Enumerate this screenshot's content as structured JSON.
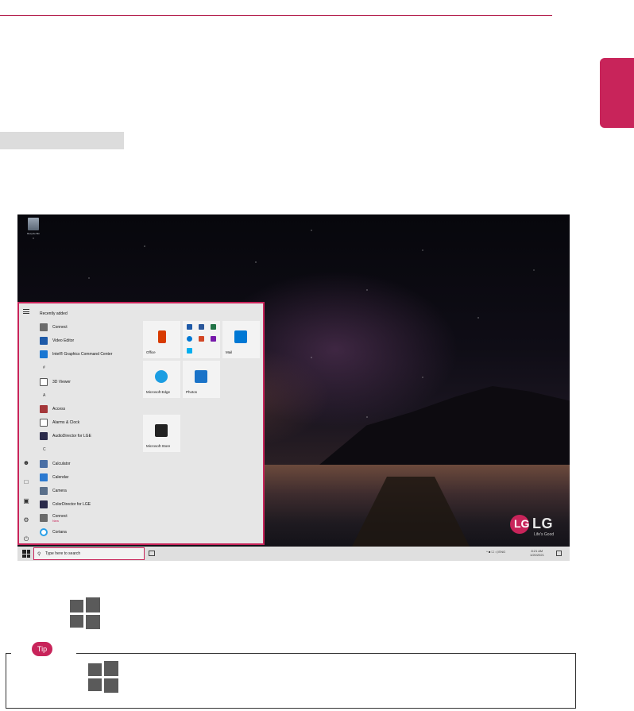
{
  "page": {
    "accent_color": "#c8245a",
    "tip_label": "Tip"
  },
  "screenshot": {
    "desktop_icon_label": "Recycle Bin",
    "start_menu": {
      "recently_added_label": "Recently added",
      "apps": [
        {
          "label": "Connect",
          "icon": "connect-icon",
          "color": "#6b6b6b"
        },
        {
          "label": "Video Editor",
          "icon": "video-editor-icon",
          "color": "#1e5aa8"
        },
        {
          "label": "Intel® Graphics Command Center",
          "icon": "intel-graphics-icon",
          "color": "#1976d2"
        },
        {
          "section": "#"
        },
        {
          "label": "3D Viewer",
          "icon": "cube-icon",
          "color": "#555555"
        },
        {
          "section": "A"
        },
        {
          "label": "Access",
          "icon": "access-icon",
          "color": "#a4373a"
        },
        {
          "label": "Alarms & Clock",
          "icon": "clock-icon",
          "color": "#555555"
        },
        {
          "label": "AudioDirector for LGE",
          "icon": "audiodirector-icon",
          "color": "#2a2a4a"
        },
        {
          "section": "C"
        },
        {
          "label": "Calculator",
          "icon": "calculator-icon",
          "color": "#4a6fa5"
        },
        {
          "label": "Calendar",
          "icon": "calendar-icon",
          "color": "#2b79d0"
        },
        {
          "label": "Camera",
          "icon": "camera-icon",
          "color": "#5a6f8a"
        },
        {
          "label": "ColorDirector for LGE",
          "icon": "colordirector-icon",
          "color": "#2a2a4a"
        },
        {
          "label": "Connect",
          "sub": "New",
          "icon": "connect-icon",
          "color": "#6b6b6b"
        },
        {
          "label": "Cortana",
          "icon": "cortana-icon",
          "color": "#2aa0e8"
        }
      ],
      "tiles": {
        "office": "Office",
        "mail": "Mail",
        "edge": "Microsoft Edge",
        "photos": "Photos",
        "store": "Microsoft Store"
      }
    },
    "taskbar": {
      "search_placeholder": "Type here to search",
      "tray_text": "^ ■ ☐ ◁ ENG",
      "clock_time": "8:21 AM",
      "clock_date": "1/20/2021"
    },
    "brand": {
      "logo_mark": "LG",
      "logo_text": "LG",
      "tagline": "Life's Good"
    }
  }
}
